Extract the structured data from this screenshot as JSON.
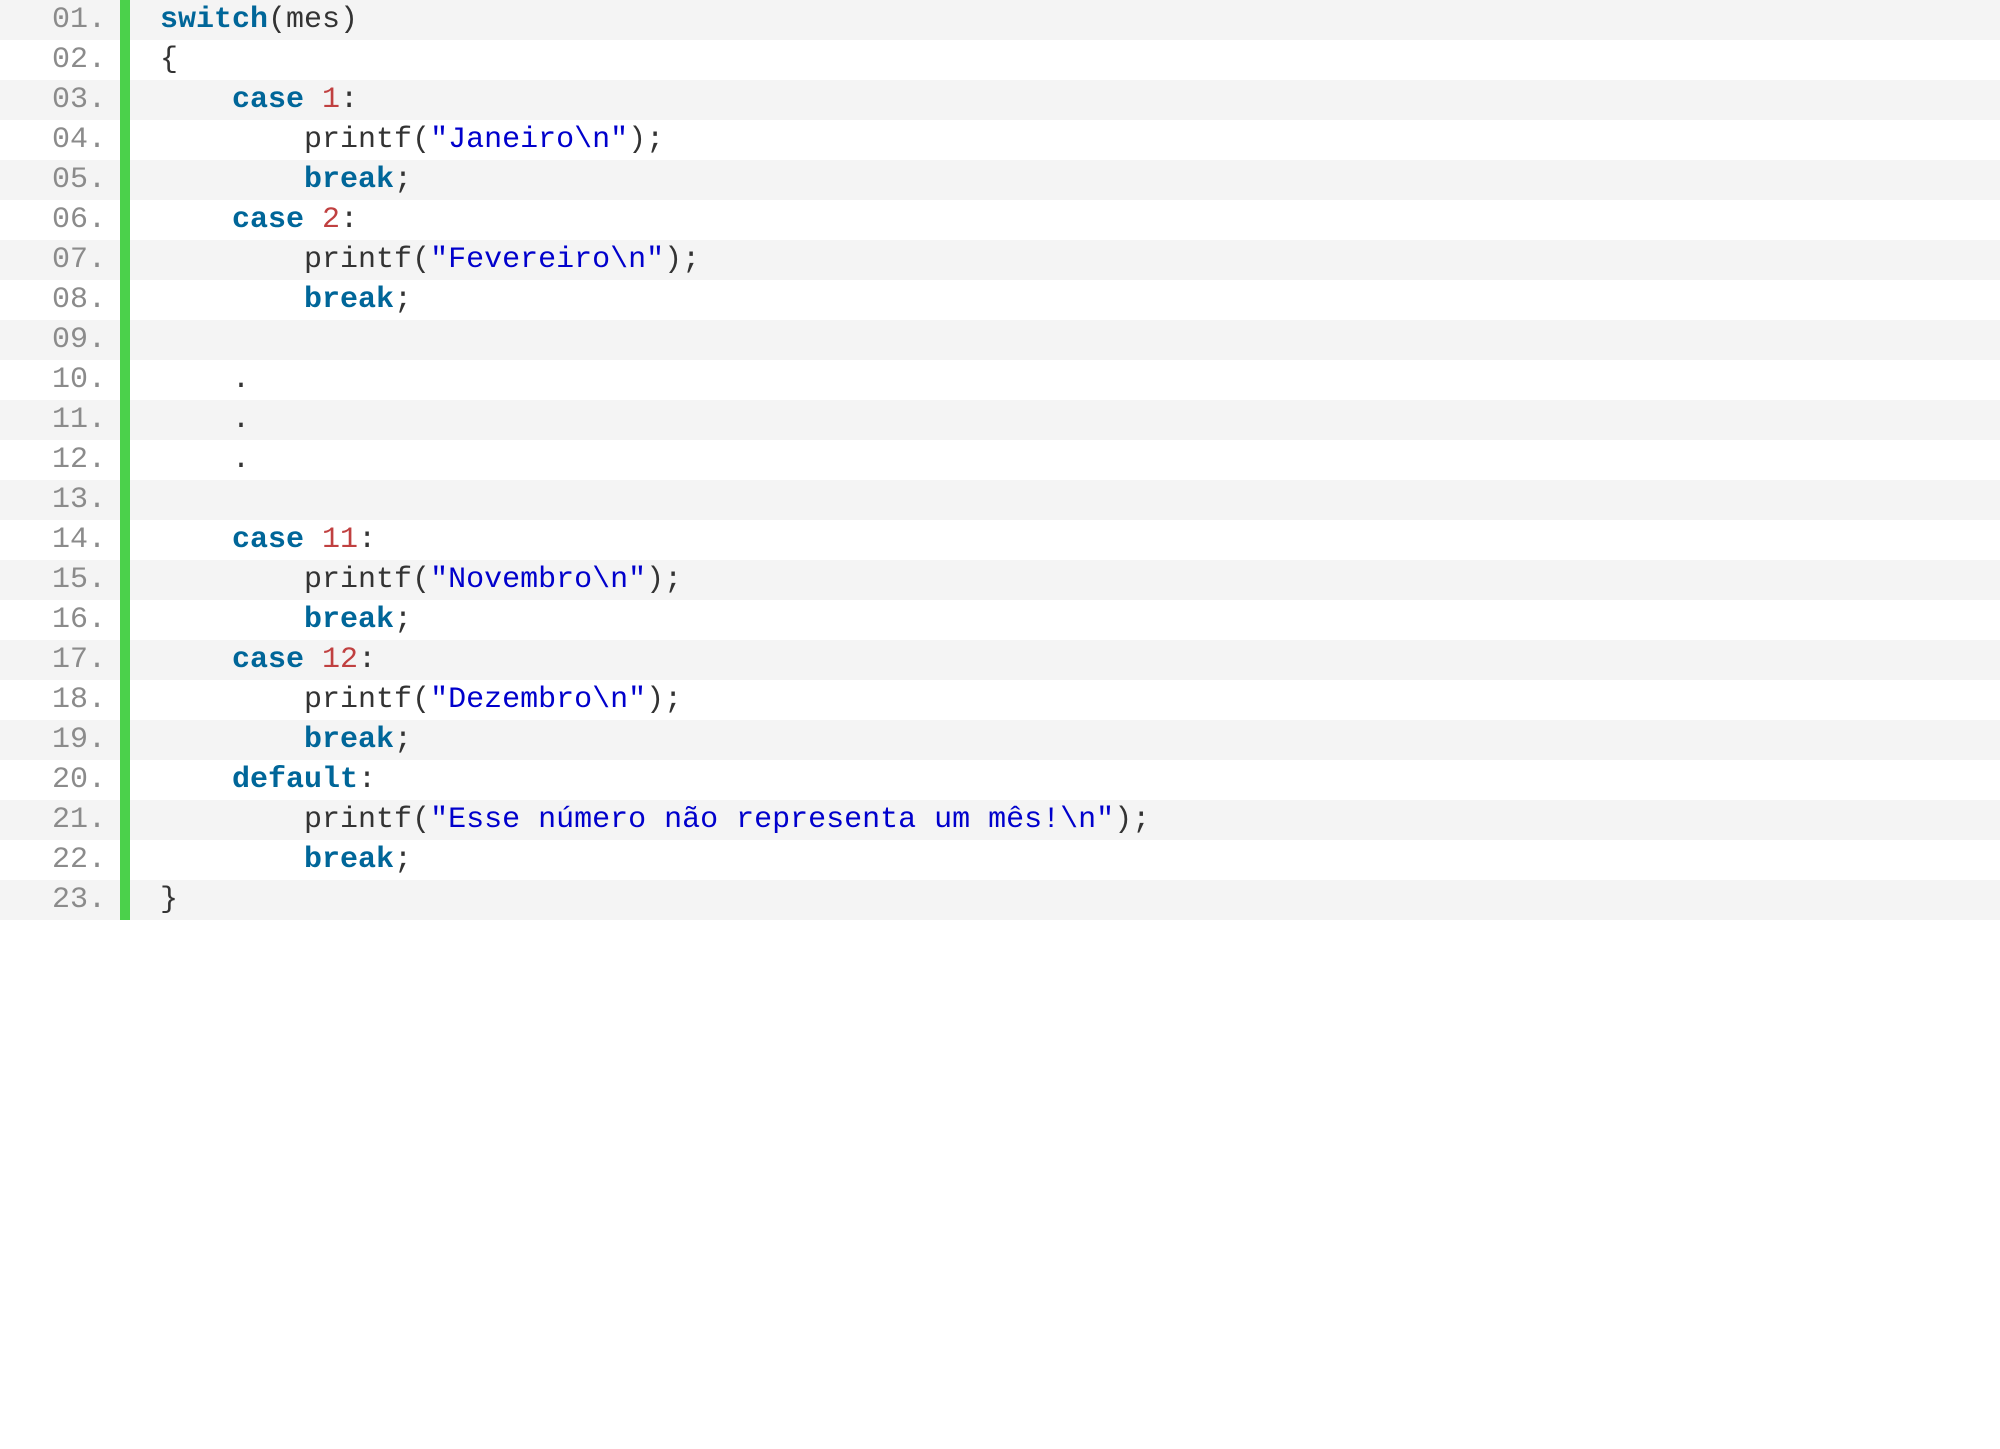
{
  "lines": [
    {
      "num": "01.",
      "tokens": [
        {
          "t": "switch",
          "c": "kw"
        },
        {
          "t": "(mes)",
          "c": "plain"
        }
      ]
    },
    {
      "num": "02.",
      "tokens": [
        {
          "t": "{",
          "c": "plain"
        }
      ]
    },
    {
      "num": "03.",
      "tokens": [
        {
          "t": "    ",
          "c": "plain"
        },
        {
          "t": "case",
          "c": "kw"
        },
        {
          "t": " ",
          "c": "plain"
        },
        {
          "t": "1",
          "c": "num"
        },
        {
          "t": ":",
          "c": "plain"
        }
      ]
    },
    {
      "num": "04.",
      "tokens": [
        {
          "t": "        ",
          "c": "plain"
        },
        {
          "t": "printf",
          "c": "fn"
        },
        {
          "t": "(",
          "c": "plain"
        },
        {
          "t": "\"Janeiro\\n\"",
          "c": "str"
        },
        {
          "t": ");",
          "c": "plain"
        }
      ]
    },
    {
      "num": "05.",
      "tokens": [
        {
          "t": "        ",
          "c": "plain"
        },
        {
          "t": "break",
          "c": "kw"
        },
        {
          "t": ";",
          "c": "plain"
        }
      ]
    },
    {
      "num": "06.",
      "tokens": [
        {
          "t": "    ",
          "c": "plain"
        },
        {
          "t": "case",
          "c": "kw"
        },
        {
          "t": " ",
          "c": "plain"
        },
        {
          "t": "2",
          "c": "num"
        },
        {
          "t": ":",
          "c": "plain"
        }
      ]
    },
    {
      "num": "07.",
      "tokens": [
        {
          "t": "        ",
          "c": "plain"
        },
        {
          "t": "printf",
          "c": "fn"
        },
        {
          "t": "(",
          "c": "plain"
        },
        {
          "t": "\"Fevereiro\\n\"",
          "c": "str"
        },
        {
          "t": ");",
          "c": "plain"
        }
      ]
    },
    {
      "num": "08.",
      "tokens": [
        {
          "t": "        ",
          "c": "plain"
        },
        {
          "t": "break",
          "c": "kw"
        },
        {
          "t": ";",
          "c": "plain"
        }
      ]
    },
    {
      "num": "09.",
      "tokens": [
        {
          "t": " ",
          "c": "plain"
        }
      ]
    },
    {
      "num": "10.",
      "tokens": [
        {
          "t": "    .",
          "c": "plain"
        }
      ]
    },
    {
      "num": "11.",
      "tokens": [
        {
          "t": "    .",
          "c": "plain"
        }
      ]
    },
    {
      "num": "12.",
      "tokens": [
        {
          "t": "    .",
          "c": "plain"
        }
      ]
    },
    {
      "num": "13.",
      "tokens": [
        {
          "t": " ",
          "c": "plain"
        }
      ]
    },
    {
      "num": "14.",
      "tokens": [
        {
          "t": "    ",
          "c": "plain"
        },
        {
          "t": "case",
          "c": "kw"
        },
        {
          "t": " ",
          "c": "plain"
        },
        {
          "t": "11",
          "c": "num"
        },
        {
          "t": ":",
          "c": "plain"
        }
      ]
    },
    {
      "num": "15.",
      "tokens": [
        {
          "t": "        ",
          "c": "plain"
        },
        {
          "t": "printf",
          "c": "fn"
        },
        {
          "t": "(",
          "c": "plain"
        },
        {
          "t": "\"Novembro\\n\"",
          "c": "str"
        },
        {
          "t": ");",
          "c": "plain"
        }
      ]
    },
    {
      "num": "16.",
      "tokens": [
        {
          "t": "        ",
          "c": "plain"
        },
        {
          "t": "break",
          "c": "kw"
        },
        {
          "t": ";",
          "c": "plain"
        }
      ]
    },
    {
      "num": "17.",
      "tokens": [
        {
          "t": "    ",
          "c": "plain"
        },
        {
          "t": "case",
          "c": "kw"
        },
        {
          "t": " ",
          "c": "plain"
        },
        {
          "t": "12",
          "c": "num"
        },
        {
          "t": ":",
          "c": "plain"
        }
      ]
    },
    {
      "num": "18.",
      "tokens": [
        {
          "t": "        ",
          "c": "plain"
        },
        {
          "t": "printf",
          "c": "fn"
        },
        {
          "t": "(",
          "c": "plain"
        },
        {
          "t": "\"Dezembro\\n\"",
          "c": "str"
        },
        {
          "t": ");",
          "c": "plain"
        }
      ]
    },
    {
      "num": "19.",
      "tokens": [
        {
          "t": "        ",
          "c": "plain"
        },
        {
          "t": "break",
          "c": "kw"
        },
        {
          "t": ";",
          "c": "plain"
        }
      ]
    },
    {
      "num": "20.",
      "tokens": [
        {
          "t": "    ",
          "c": "plain"
        },
        {
          "t": "default",
          "c": "kw"
        },
        {
          "t": ":",
          "c": "plain"
        }
      ]
    },
    {
      "num": "21.",
      "tokens": [
        {
          "t": "        ",
          "c": "plain"
        },
        {
          "t": "printf",
          "c": "fn"
        },
        {
          "t": "(",
          "c": "plain"
        },
        {
          "t": "\"Esse número não representa um mês!\\n\"",
          "c": "str"
        },
        {
          "t": ");",
          "c": "plain"
        }
      ]
    },
    {
      "num": "22.",
      "tokens": [
        {
          "t": "        ",
          "c": "plain"
        },
        {
          "t": "break",
          "c": "kw"
        },
        {
          "t": ";",
          "c": "plain"
        }
      ]
    },
    {
      "num": "23.",
      "tokens": [
        {
          "t": "}",
          "c": "plain"
        }
      ]
    }
  ]
}
